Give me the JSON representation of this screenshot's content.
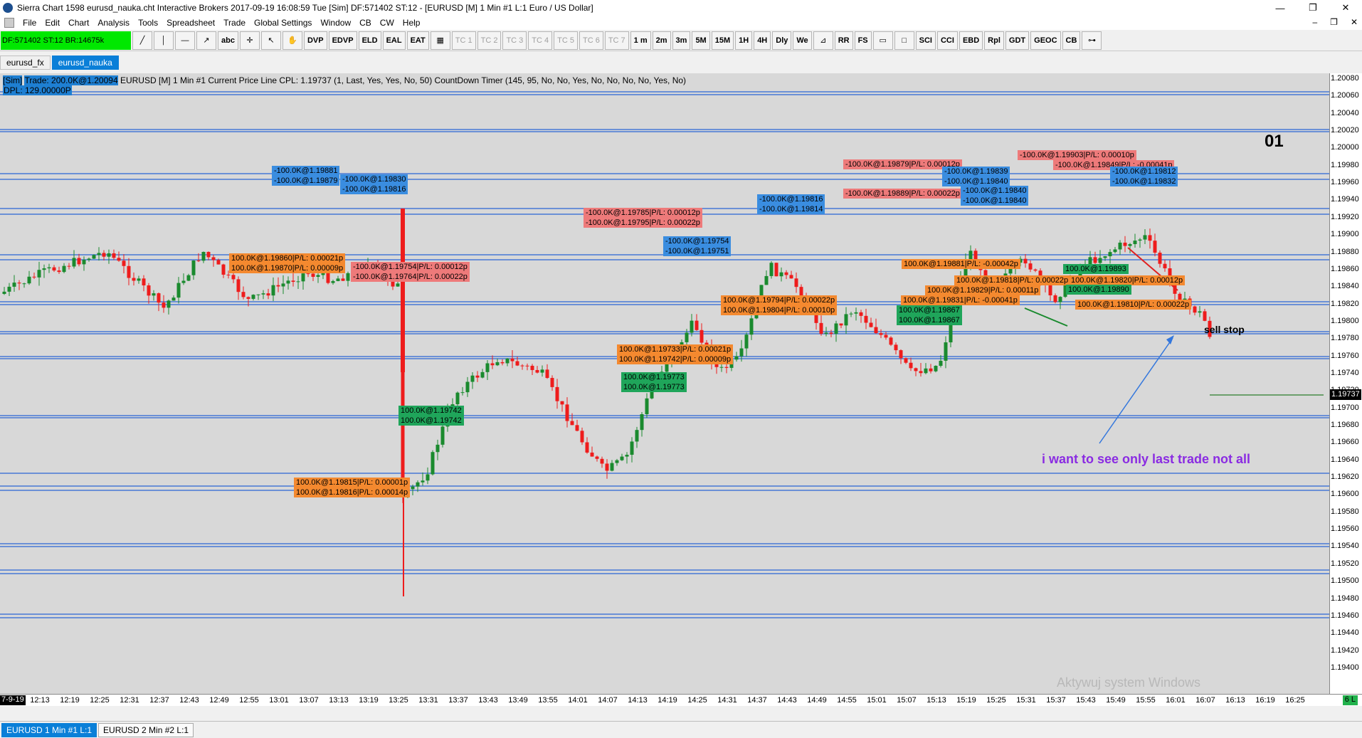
{
  "window": {
    "title": "Sierra Chart 1598 eurusd_nauka.cht  Interactive Brokers 2017-09-19  16:08:59 Tue [Sim]  DF:571402  ST:12 - [EURUSD [M]  1 Min  #1  L:1  Euro / US Dollar]",
    "controls": [
      "—",
      "❐",
      "✕"
    ]
  },
  "menu": {
    "items": [
      "File",
      "Edit",
      "Chart",
      "Analysis",
      "Tools",
      "Spreadsheet",
      "Trade",
      "Global Settings",
      "Window",
      "CB",
      "CW",
      "Help"
    ],
    "right_controls": [
      "–",
      "❐",
      "✕"
    ]
  },
  "toolbar": {
    "status": "DF:571402  ST:12  BR:14675k",
    "text_buttons": [
      "abc",
      "DVP",
      "EDVP",
      "ELD",
      "EAL",
      "EAT",
      "TC 1",
      "TC 2",
      "TC 3",
      "TC 4",
      "TC 5",
      "TC 6",
      "TC 7",
      "1 m",
      "2m",
      "3m",
      "5M",
      "15M",
      "1H",
      "4H",
      "Dly",
      "We",
      "RR",
      "FS",
      "SCI",
      "CCI",
      "EBD",
      "Rpl",
      "GDT",
      "GEOC",
      "CB"
    ]
  },
  "chart_tabs": [
    "eurusd_fx",
    "eurusd_nauka"
  ],
  "study_line": {
    "sim": "[Sim]",
    "trade": "Trade: 200.0K@1.20094",
    "rest": " EURUSD [M]  1 Min  #1  Current Price Line  CPL: 1.19737  (1, Last, Yes, Yes, No, 50)  CountDown Timer  (145, 95, No, No, Yes, No, No, No, No, Yes, No)",
    "dpl": "DPL: 129.00000P"
  },
  "annotations": {
    "chart_number": "01",
    "sell_stop": "sell stop",
    "note": "i want to see only last trade not all",
    "watermark": "Aktywuj system Windows"
  },
  "current_price": "1.19737",
  "y_axis_labels": [
    "1.20080",
    "1.20060",
    "1.20040",
    "1.20020",
    "1.20000",
    "1.19980",
    "1.19960",
    "1.19940",
    "1.19920",
    "1.19900",
    "1.19880",
    "1.19860",
    "1.19840",
    "1.19820",
    "1.19800",
    "1.19780",
    "1.19760",
    "1.19740",
    "1.19720",
    "1.19700",
    "1.19680",
    "1.19660",
    "1.19640",
    "1.19620",
    "1.19600",
    "1.19580",
    "1.19560",
    "1.19540",
    "1.19520",
    "1.19500",
    "1.19480",
    "1.19460",
    "1.19440",
    "1.19420",
    "1.19400"
  ],
  "x_axis": {
    "start": "7-9-19",
    "end": "6 L",
    "labels": [
      "12:13",
      "12:19",
      "12:25",
      "12:31",
      "12:37",
      "12:43",
      "12:49",
      "12:55",
      "13:01",
      "13:07",
      "13:13",
      "13:19",
      "13:25",
      "13:31",
      "13:37",
      "13:43",
      "13:49",
      "13:55",
      "14:01",
      "14:07",
      "14:13",
      "14:19",
      "14:25",
      "14:31",
      "14:37",
      "14:43",
      "14:49",
      "14:55",
      "15:01",
      "15:07",
      "15:13",
      "15:19",
      "15:25",
      "15:31",
      "15:37",
      "15:43",
      "15:49",
      "15:55",
      "16:01",
      "16:07",
      "16:13",
      "16:19",
      "16:25"
    ]
  },
  "trade_labels": [
    {
      "text": "-100.0K@1.19881",
      "color": "blue"
    },
    {
      "text": "-100.0K@1.19879",
      "color": "blue"
    },
    {
      "text": "-100.0K@1.19830",
      "color": "blue"
    },
    {
      "text": "-100.0K@1.19816",
      "color": "blue"
    },
    {
      "text": "100.0K@1.19860|P/L: 0.00021p",
      "color": "orange"
    },
    {
      "text": "100.0K@1.19870|P/L: 0.00009p",
      "color": "orange"
    },
    {
      "text": "-100.0K@1.19754|P/L: 0.00012p",
      "color": "red"
    },
    {
      "text": "-100.0K@1.19764|P/L: 0.00022p",
      "color": "red"
    },
    {
      "text": "100.0K@1.19742",
      "color": "green"
    },
    {
      "text": "100.0K@1.19742",
      "color": "green"
    },
    {
      "text": "100.0K@1.19815|P/L: 0.00001p",
      "color": "orange"
    },
    {
      "text": "100.0K@1.19816|P/L: 0.00014p",
      "color": "orange"
    },
    {
      "text": "-100.0K@1.19785|P/L: 0.00012p",
      "color": "red"
    },
    {
      "text": "-100.0K@1.19795|P/L: 0.00022p",
      "color": "red"
    },
    {
      "text": "-100.0K@1.19754",
      "color": "blue"
    },
    {
      "text": "-100.0K@1.19751",
      "color": "blue"
    },
    {
      "text": "100.0K@1.19733|P/L: 0.00021p",
      "color": "orange"
    },
    {
      "text": "100.0K@1.19742|P/L: 0.00009p",
      "color": "orange"
    },
    {
      "text": "100.0K@1.19773",
      "color": "green"
    },
    {
      "text": "100.0K@1.19773",
      "color": "green"
    },
    {
      "text": "100.0K@1.19794|P/L: 0.00022p",
      "color": "orange"
    },
    {
      "text": "100.0K@1.19804|P/L: 0.00010p",
      "color": "orange"
    },
    {
      "text": "-100.0K@1.19816",
      "color": "blue"
    },
    {
      "text": "-100.0K@1.19814",
      "color": "blue"
    },
    {
      "text": "-100.0K@1.19879|P/L: 0.00012p",
      "color": "red"
    },
    {
      "text": "-100.0K@1.19889|P/L: 0.00022p",
      "color": "red"
    },
    {
      "text": "-100.0K@1.19839",
      "color": "blue"
    },
    {
      "text": "-100.0K@1.19840",
      "color": "blue"
    },
    {
      "text": "-100.0K@1.19840",
      "color": "blue"
    },
    {
      "text": "-100.0K@1.19840",
      "color": "blue"
    },
    {
      "text": "-100.0K@1.19903|P/L: 0.00010p",
      "color": "red"
    },
    {
      "text": "-100.0K@1.19849|P/L: -0.00041p",
      "color": "red"
    },
    {
      "text": "-100.0K@1.19812",
      "color": "blue"
    },
    {
      "text": "-100.0K@1.19832",
      "color": "blue"
    },
    {
      "text": "100.0K@1.19881|P/L: -0.00042p",
      "color": "orange"
    },
    {
      "text": "100.0K@1.19818|P/L: 0.00022p",
      "color": "orange"
    },
    {
      "text": "100.0K@1.19829|P/L: 0.00011p",
      "color": "orange"
    },
    {
      "text": "100.0K@1.19831|P/L: -0.00041p",
      "color": "orange"
    },
    {
      "text": "100.0K@1.19867",
      "color": "green"
    },
    {
      "text": "100.0K@1.19867",
      "color": "green"
    },
    {
      "text": "100.0K@1.19893",
      "color": "green"
    },
    {
      "text": "100.0K@1.19820|P/L: 0.00012p",
      "color": "orange"
    },
    {
      "text": "100.0K@1.19890",
      "color": "green"
    },
    {
      "text": "100.0K@1.19810|P/L: 0.00022p",
      "color": "orange"
    }
  ],
  "bottom_tabs": [
    "EURUSD  1 Min  #1  L:1",
    "EURUSD  2 Min  #2  L:1"
  ],
  "colors": {
    "up": "#1a8a2e",
    "down": "#ee1c1c",
    "level": "#2a66d4",
    "arrow": "#3377dd",
    "note": "#8a2be2"
  }
}
